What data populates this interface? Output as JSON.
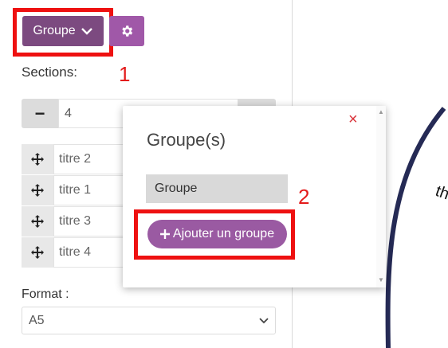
{
  "toolbar": {
    "group_label": "Groupe",
    "callout_1": "1"
  },
  "sections": {
    "label": "Sections:",
    "count_value": "4",
    "minus_label": "−",
    "titles": [
      "titre 2",
      "titre 1",
      "titre 3",
      "titre 4"
    ]
  },
  "format": {
    "label": "Format :",
    "selected": "A5"
  },
  "popup": {
    "title": "Groupe(s)",
    "close": "×",
    "group_value": "Groupe",
    "add_button": "Ajouter un groupe",
    "callout_2": "2"
  },
  "preview": {
    "fragment_text": "th"
  },
  "colors": {
    "primary": "#7c4a80",
    "accent": "#9a5aa2",
    "highlight": "#ee1111"
  }
}
